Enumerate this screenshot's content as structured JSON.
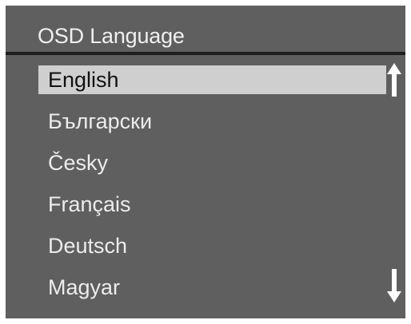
{
  "menu": {
    "title": "OSD Language",
    "languages": [
      {
        "label": "English",
        "selected": true
      },
      {
        "label": "Български",
        "selected": false
      },
      {
        "label": "Česky",
        "selected": false
      },
      {
        "label": "Français",
        "selected": false
      },
      {
        "label": "Deutsch",
        "selected": false
      },
      {
        "label": "Magyar",
        "selected": false
      }
    ],
    "scroll_up_icon": "arrow-up-icon",
    "scroll_down_icon": "arrow-down-icon"
  },
  "colors": {
    "panel_background": "#5f5f5f",
    "divider": "#1e1e1e",
    "selection_highlight": "#cfcfcf",
    "text": "#ececec",
    "selected_text": "#111111"
  }
}
